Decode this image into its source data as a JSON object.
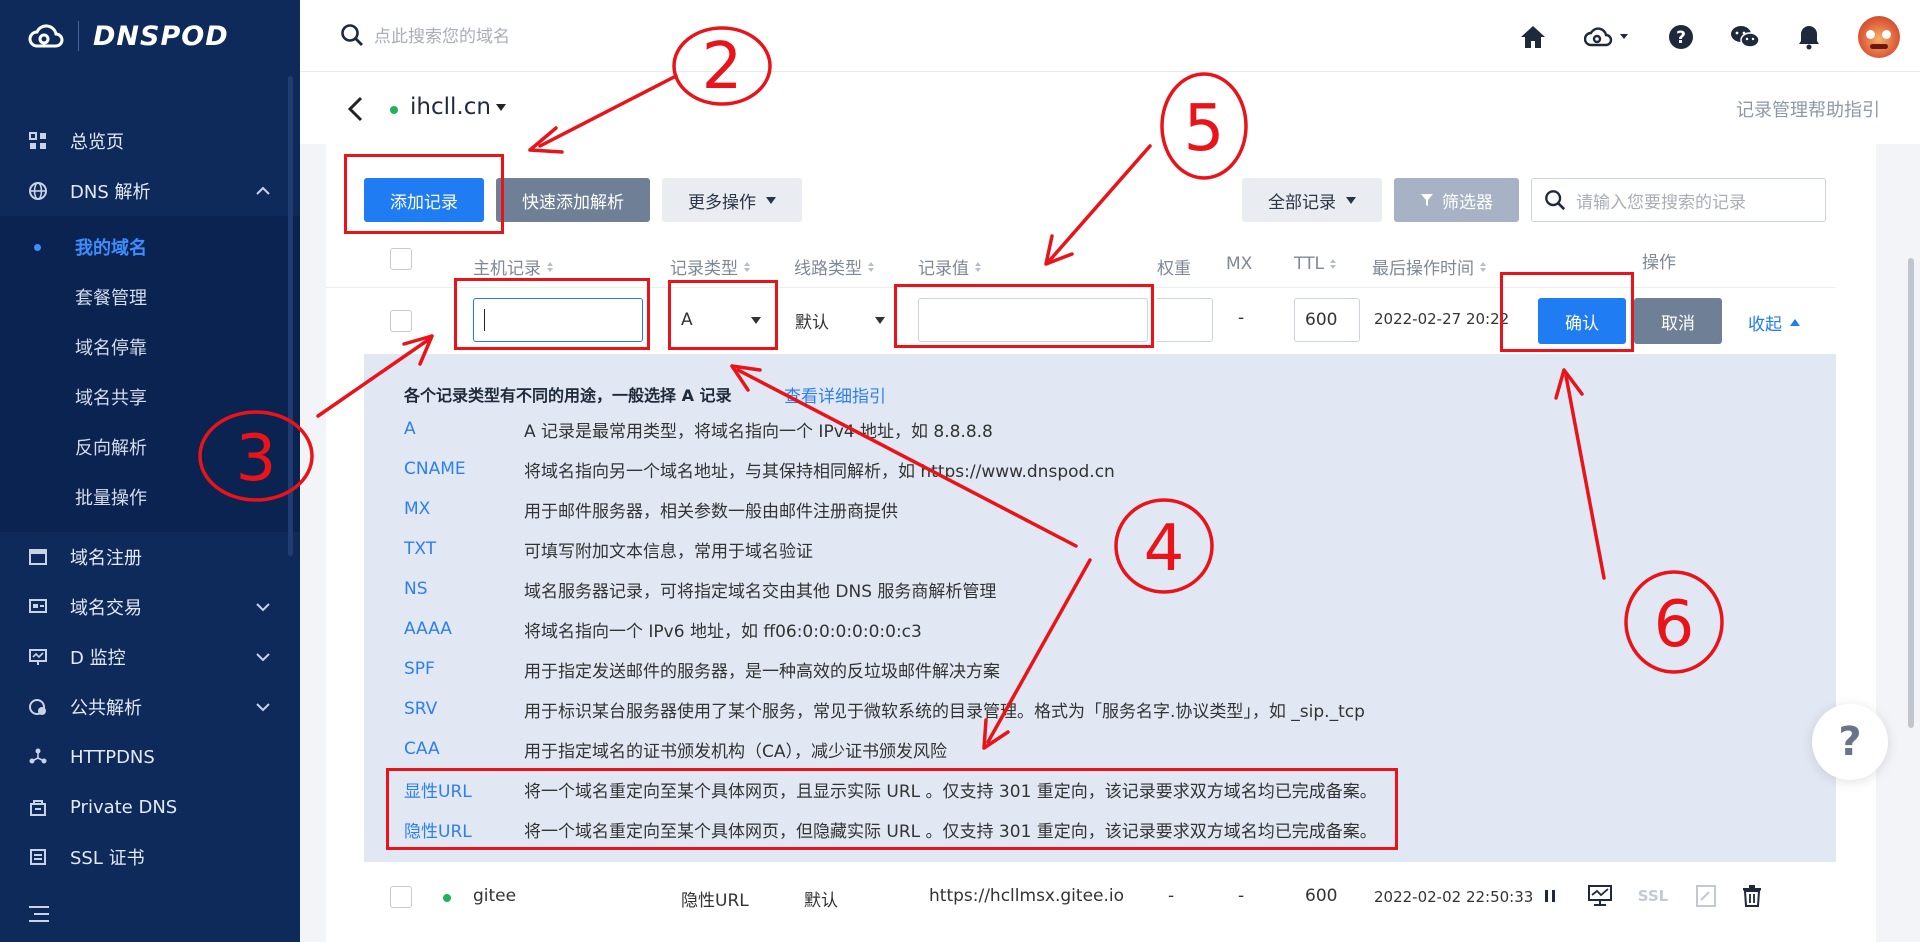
{
  "brand": {
    "logo_text": "DNSPOD"
  },
  "sidebar": {
    "items": [
      {
        "label": "总览页",
        "icon": "dashboard-icon"
      },
      {
        "label": "DNS 解析",
        "icon": "globe-icon",
        "expanded": true
      },
      {
        "label": "域名注册",
        "icon": "register-icon"
      },
      {
        "label": "域名交易",
        "icon": "trade-icon"
      },
      {
        "label": "D 监控",
        "icon": "monitor-icon"
      },
      {
        "label": "公共解析",
        "icon": "public-dns-icon"
      },
      {
        "label": "HTTPDNS",
        "icon": "httpdns-icon"
      },
      {
        "label": "Private DNS",
        "icon": "private-dns-icon"
      },
      {
        "label": "SSL 证书",
        "icon": "ssl-cert-icon"
      }
    ],
    "dns_sub": [
      "我的域名",
      "套餐管理",
      "域名停靠",
      "域名共享",
      "反向解析",
      "批量操作"
    ]
  },
  "topbar": {
    "search_placeholder": "点此搜索您的域名"
  },
  "subheader": {
    "domain": "ihcll.cn",
    "help_guide": "记录管理帮助指引"
  },
  "toolbar": {
    "add_record": "添加记录",
    "quick_add": "快速添加解析",
    "more_ops": "更多操作",
    "all_records": "全部记录",
    "filter": "筛选器",
    "search_placeholder": "请输入您要搜索的记录"
  },
  "table": {
    "headers": {
      "host": "主机记录",
      "type": "记录类型",
      "line": "线路类型",
      "value": "记录值",
      "weight": "权重",
      "mx": "MX",
      "ttl": "TTL",
      "last_op": "最后操作时间",
      "ops": "操作"
    },
    "edit_row": {
      "type": "A",
      "line": "默认",
      "mx": "-",
      "ttl": "600",
      "time": "2022-02-27 20:22",
      "confirm": "确认",
      "cancel": "取消",
      "collapse": "收起"
    },
    "rows": [
      {
        "host": "gitee",
        "type": "隐性URL",
        "line": "默认",
        "value": "https://hcllmsx.gitee.io",
        "weight": "-",
        "mx": "-",
        "ttl": "600",
        "time": "2022-02-02 22:50:33",
        "ssl": "SSL"
      }
    ]
  },
  "help_panel": {
    "title": "各个记录类型有不同的用途，一般选择 A 记录",
    "link": "查看详细指引",
    "types": [
      {
        "name": "A",
        "desc": "A 记录是最常用类型，将域名指向一个 IPv4 地址，如 8.8.8.8"
      },
      {
        "name": "CNAME",
        "desc": "将域名指向另一个域名地址，与其保持相同解析，如 https://www.dnspod.cn"
      },
      {
        "name": "MX",
        "desc": "用于邮件服务器，相关参数一般由邮件注册商提供"
      },
      {
        "name": "TXT",
        "desc": "可填写附加文本信息，常用于域名验证"
      },
      {
        "name": "NS",
        "desc": "域名服务器记录，可将指定域名交由其他 DNS 服务商解析管理"
      },
      {
        "name": "AAAA",
        "desc": "将域名指向一个 IPv6 地址，如 ff06:0:0:0:0:0:0:c3"
      },
      {
        "name": "SPF",
        "desc": "用于指定发送邮件的服务器，是一种高效的反垃圾邮件解决方案"
      },
      {
        "name": "SRV",
        "desc": "用于标识某台服务器使用了某个服务，常见于微软系统的目录管理。格式为「服务名字.协议类型」，如 _sip._tcp"
      },
      {
        "name": "CAA",
        "desc": "用于指定域名的证书颁发机构（CA），减少证书颁发风险"
      },
      {
        "name": "显性URL",
        "desc": "将一个域名重定向至某个具体网页，且显示实际 URL 。仅支持 301 重定向，该记录要求双方域名均已完成备案。"
      },
      {
        "name": "隐性URL",
        "desc": "将一个域名重定向至某个具体网页，但隐藏实际 URL 。仅支持 301 重定向，该记录要求双方域名均已完成备案。"
      }
    ]
  },
  "help_bubble": "?",
  "annotations": {
    "color": "#e8141a"
  }
}
